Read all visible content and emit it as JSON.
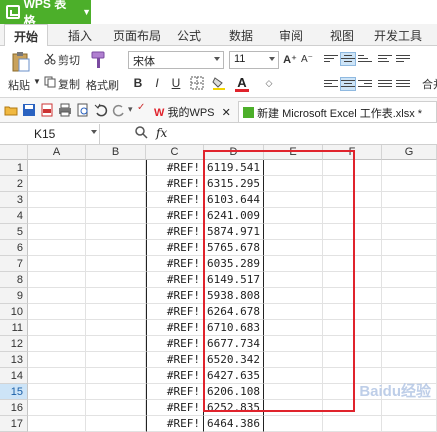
{
  "app": {
    "name": "WPS 表格"
  },
  "ribbon_tabs": [
    "开始",
    "插入",
    "页面布局",
    "公式",
    "数据",
    "审阅",
    "视图",
    "开发工具"
  ],
  "clipboard": {
    "paste": "粘贴",
    "cut": "剪切",
    "copy": "复制",
    "format_painter": "格式刷"
  },
  "font": {
    "name": "宋体",
    "size": "11"
  },
  "format_buttons": {
    "bold": "B",
    "italic": "I",
    "underline": "U"
  },
  "merge_label": "合并",
  "quick_access": {
    "dropdown": "▾"
  },
  "doc_tabs": [
    {
      "label": "我的WPS"
    },
    {
      "label": "新建 Microsoft Excel 工作表.xlsx *"
    }
  ],
  "formula_bar": {
    "name_box": "K15",
    "fx": "fx",
    "magnifier": "Q"
  },
  "columns": [
    "A",
    "B",
    "C",
    "D",
    "E",
    "F",
    "G"
  ],
  "rows": [
    {
      "n": "1",
      "c": "#REF!",
      "d": "6119.541"
    },
    {
      "n": "2",
      "c": "#REF!",
      "d": "6315.295"
    },
    {
      "n": "3",
      "c": "#REF!",
      "d": "6103.644"
    },
    {
      "n": "4",
      "c": "#REF!",
      "d": "6241.009"
    },
    {
      "n": "5",
      "c": "#REF!",
      "d": "5874.971"
    },
    {
      "n": "6",
      "c": "#REF!",
      "d": "5765.678"
    },
    {
      "n": "7",
      "c": "#REF!",
      "d": "6035.289"
    },
    {
      "n": "8",
      "c": "#REF!",
      "d": "6149.517"
    },
    {
      "n": "9",
      "c": "#REF!",
      "d": "5938.808"
    },
    {
      "n": "10",
      "c": "#REF!",
      "d": "6264.678"
    },
    {
      "n": "11",
      "c": "#REF!",
      "d": "6710.683"
    },
    {
      "n": "12",
      "c": "#REF!",
      "d": "6677.734"
    },
    {
      "n": "13",
      "c": "#REF!",
      "d": "6520.342"
    },
    {
      "n": "14",
      "c": "#REF!",
      "d": "6427.635"
    },
    {
      "n": "15",
      "c": "#REF!",
      "d": "6206.108"
    },
    {
      "n": "16",
      "c": "#REF!",
      "d": "6252.835"
    },
    {
      "n": "17",
      "c": "#REF!",
      "d": "6464.386"
    }
  ],
  "watermark": "Baidu经验",
  "colors": {
    "brand": "#4caf2a",
    "highlight": "#e0232c",
    "selected_row": "#cde4f7"
  }
}
